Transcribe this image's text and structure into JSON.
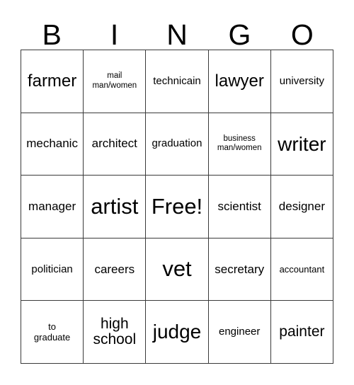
{
  "card": {
    "title": "BINGO",
    "header": {
      "letters": [
        "B",
        "I",
        "N",
        "G",
        "O"
      ]
    },
    "grid": {
      "columns": 5,
      "rows": 5,
      "border_color": "#3a3a3a",
      "background_color": "#ffffff",
      "text_color": "#000000"
    },
    "cells": [
      {
        "text": "farmer",
        "size": "xxl",
        "column": "B",
        "row": 1
      },
      {
        "text": "mail\nman/women",
        "size": "xs",
        "column": "I",
        "row": 1
      },
      {
        "text": "technicain",
        "size": "m",
        "column": "N",
        "row": 1
      },
      {
        "text": "lawyer",
        "size": "xxl",
        "column": "G",
        "row": 1
      },
      {
        "text": "university",
        "size": "m",
        "column": "O",
        "row": 1
      },
      {
        "text": "mechanic",
        "size": "l",
        "column": "B",
        "row": 2
      },
      {
        "text": "architect",
        "size": "l",
        "column": "I",
        "row": 2
      },
      {
        "text": "graduation",
        "size": "m",
        "column": "N",
        "row": 2
      },
      {
        "text": "business\nman/women",
        "size": "xs",
        "column": "G",
        "row": 2
      },
      {
        "text": "writer",
        "size": "xxxl",
        "column": "O",
        "row": 2
      },
      {
        "text": "manager",
        "size": "l",
        "column": "B",
        "row": 3
      },
      {
        "text": "artist",
        "size": "huge",
        "column": "I",
        "row": 3
      },
      {
        "text": "Free!",
        "size": "huge",
        "column": "N",
        "row": 3
      },
      {
        "text": "scientist",
        "size": "l",
        "column": "G",
        "row": 3
      },
      {
        "text": "designer",
        "size": "l",
        "column": "O",
        "row": 3
      },
      {
        "text": "politician",
        "size": "m",
        "column": "B",
        "row": 4
      },
      {
        "text": "careers",
        "size": "l",
        "column": "I",
        "row": 4
      },
      {
        "text": "vet",
        "size": "huge",
        "column": "N",
        "row": 4
      },
      {
        "text": "secretary",
        "size": "l",
        "column": "G",
        "row": 4
      },
      {
        "text": "accountant",
        "size": "s",
        "column": "O",
        "row": 4
      },
      {
        "text": "to\ngraduate",
        "size": "s",
        "column": "B",
        "row": 5
      },
      {
        "text": "high\nschool",
        "size": "xl",
        "column": "I",
        "row": 5
      },
      {
        "text": "judge",
        "size": "xxxl",
        "column": "N",
        "row": 5
      },
      {
        "text": "engineer",
        "size": "m",
        "column": "G",
        "row": 5
      },
      {
        "text": "painter",
        "size": "xl",
        "column": "O",
        "row": 5
      }
    ]
  }
}
